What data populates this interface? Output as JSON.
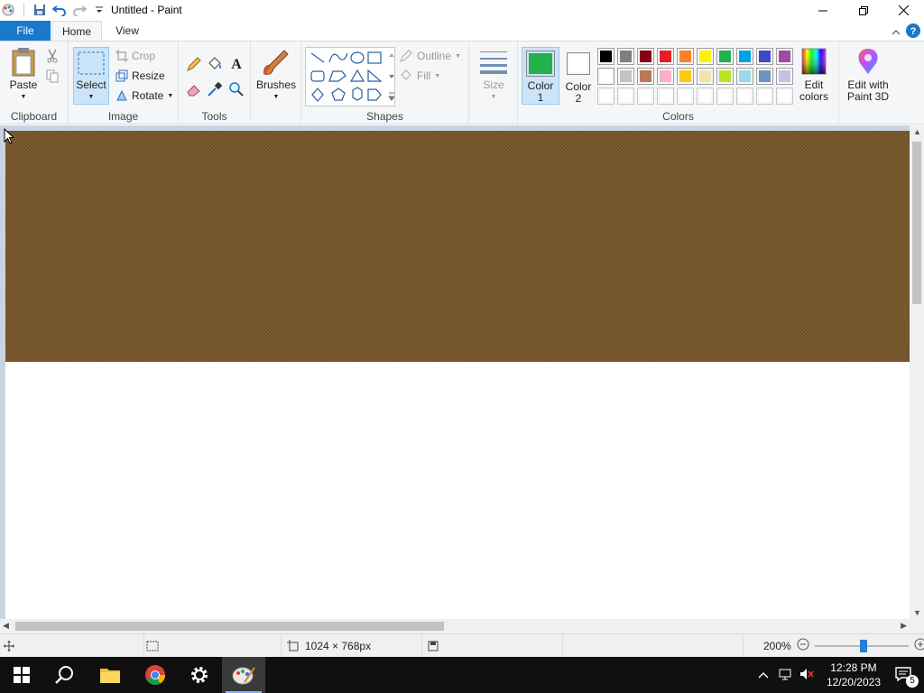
{
  "window": {
    "title": "Untitled - Paint"
  },
  "tabs": [
    {
      "label": "File"
    },
    {
      "label": "Home"
    },
    {
      "label": "View"
    }
  ],
  "ribbon": {
    "clipboard": {
      "paste_label": "Paste",
      "group_label": "Clipboard"
    },
    "image": {
      "select_label": "Select",
      "crop_label": "Crop",
      "resize_label": "Resize",
      "rotate_label": "Rotate",
      "group_label": "Image"
    },
    "tools": {
      "group_label": "Tools"
    },
    "brushes": {
      "label": "Brushes"
    },
    "shapes": {
      "outline_label": "Outline",
      "fill_label": "Fill",
      "group_label": "Shapes"
    },
    "size": {
      "label": "Size"
    },
    "colors": {
      "color1_label": "Color",
      "color1_num": "1",
      "color2_label": "Color",
      "color2_num": "2",
      "color1_value": "#22b14c",
      "color2_value": "#ffffff",
      "edit_colors_line1": "Edit",
      "edit_colors_line2": "colors",
      "group_label": "Colors",
      "palette_row1": [
        "#000000",
        "#7f7f7f",
        "#880015",
        "#ed1c24",
        "#ff7f27",
        "#fff200",
        "#22b14c",
        "#00a2e8",
        "#3f48cc",
        "#a349a4"
      ],
      "palette_row2": [
        "#ffffff",
        "#c3c3c3",
        "#b97a57",
        "#ffaec9",
        "#ffc90e",
        "#efe4b0",
        "#b5e61d",
        "#99d9ea",
        "#7092be",
        "#c8bfe7"
      ],
      "palette_row3": [
        "#ffffff",
        "#ffffff",
        "#ffffff",
        "#ffffff",
        "#ffffff",
        "#ffffff",
        "#ffffff",
        "#ffffff",
        "#ffffff",
        "#ffffff"
      ]
    },
    "paint3d": {
      "line1": "Edit with",
      "line2": "Paint 3D"
    }
  },
  "canvas": {
    "fill_color": "#7e5c30"
  },
  "statusbar": {
    "dimensions": "1024 × 768px",
    "zoom": "200%",
    "zoom_slider_fraction": 0.52
  },
  "taskbar": {
    "time": "12:28 PM",
    "date": "12/20/2023",
    "notification_count": "5"
  }
}
